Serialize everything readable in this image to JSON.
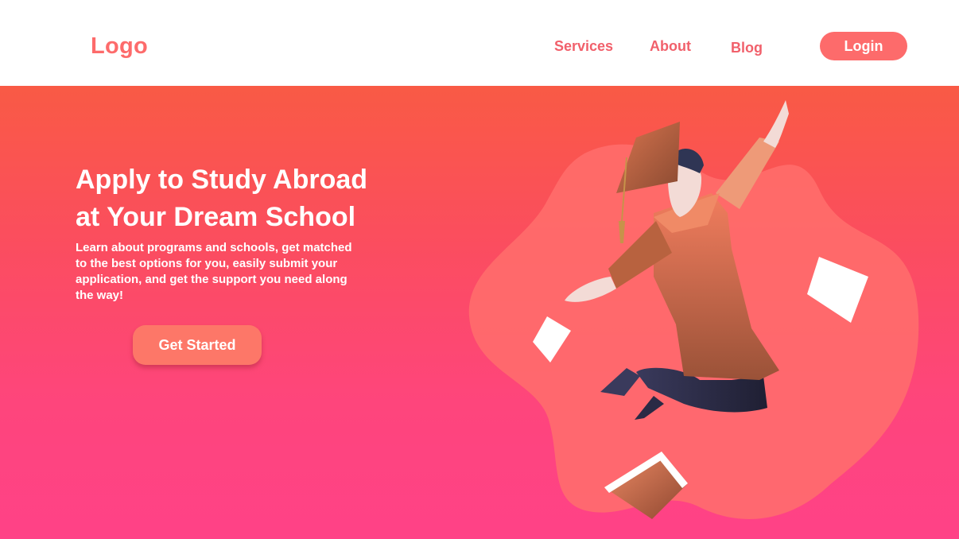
{
  "header": {
    "logo": "Logo",
    "nav": [
      {
        "label": "Services"
      },
      {
        "label": "About"
      },
      {
        "label": "Blog"
      }
    ],
    "login_label": "Login"
  },
  "hero": {
    "title_line1": "Apply to Study Abroad",
    "title_line2": "at Your Dream School",
    "description": "Learn about programs and schools, get matched to the best options for you, easily submit your application, and get the support you need along the way!",
    "cta_label": "Get Started"
  },
  "colors": {
    "accent": "#fd6b6b",
    "gradient_top": "#f95a45",
    "gradient_bottom": "#ff4287",
    "gown": "#c26a4a"
  },
  "icons": {
    "illustration": "graduate-jumping-illustration",
    "papers": "flying-paper-icon",
    "book": "book-icon"
  }
}
